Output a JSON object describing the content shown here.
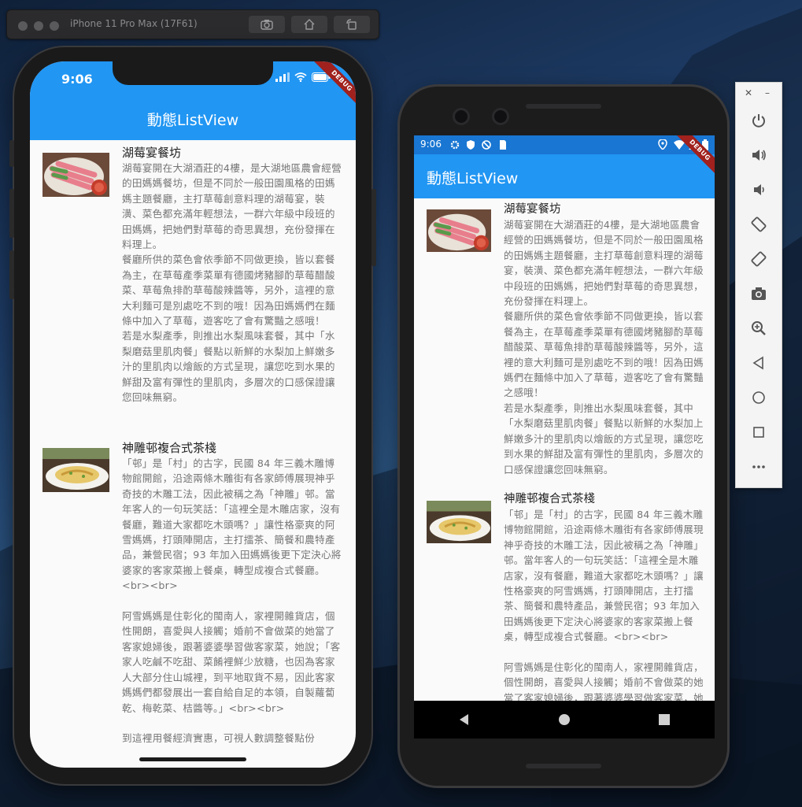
{
  "simulator": {
    "title": "iPhone 11 Pro Max (17F61)"
  },
  "ios": {
    "time": "9:06",
    "app_title": "動態ListView",
    "debug": "DEBUG"
  },
  "android": {
    "time": "9:06",
    "app_title": "動態ListView",
    "debug": "DEBUG"
  },
  "items": [
    {
      "title": "湖莓宴餐坊",
      "desc": "湖莓宴開在大湖酒莊的4樓，是大湖地區農會經營的田媽媽餐坊，但是不同於一般田園風格的田媽媽主題餐廳，主打草莓創意料理的湖莓宴，裝潢、菜色都充滿年輕想法，一群六年級中段班的田媽媽，把她們對草莓的奇思異想，充份發揮在料理上。\n餐廳所供的菜色會依季節不同做更換，皆以套餐為主，在草莓產季菜單有德國烤豬腳酌草莓醋酸菜、草莓魚排酌草莓酸辣醬等，另外，這裡的意大利麵可是別處吃不到的哦！因為田媽媽們在麵條中加入了草莓，遊客吃了會有驚豔之感哦！\n若是水梨產季，則推出水梨風味套餐，其中「水梨磨菇里肌肉餐」餐點以新鮮的水梨加上鮮嫩多汁的里肌肉以燴飯的方式呈現，讓您吃到水果的鮮甜及富有彈性的里肌肉，多層次的口感保證讓您回味無窮。"
    },
    {
      "title": "神雕邨複合式茶棧",
      "desc": "「邨」是「村」的古字，民國 84 年三義木雕博物館開館，沿途兩條木雕街有各家師傅展現神乎奇技的木雕工法，因此被稱之為「神雕」邨。當年客人的一句玩笑話：「這裡全是木雕店家，沒有餐廳，難道大家都吃木頭嗎？」讓性格豪爽的阿雪媽媽，打頭陣開店，主打擂茶、簡餐和農特產品，兼營民宿；93 年加入田媽媽後更下定決心將婆家的客家菜搬上餐桌，轉型成複合式餐廳。<br><br>\n\n阿雪媽媽是住彰化的閩南人，家裡開雜貨店，個性開朗，喜愛與人接觸；婚前不會做菜的她當了客家媳婦後，跟著婆婆學習做客家菜，她說；「客家人吃鹹不吃甜、菜餚裡鮮少放糖，也因為客家人大部分住山城裡，到平地取貨不易，因此客家媽媽們都發展出一套自給自足的本領，自製蘿蔔乾、梅乾菜、桔醬等。」<br><br>\n\n到這裡用餐經濟實惠，可視人數調整餐點份"
    }
  ]
}
